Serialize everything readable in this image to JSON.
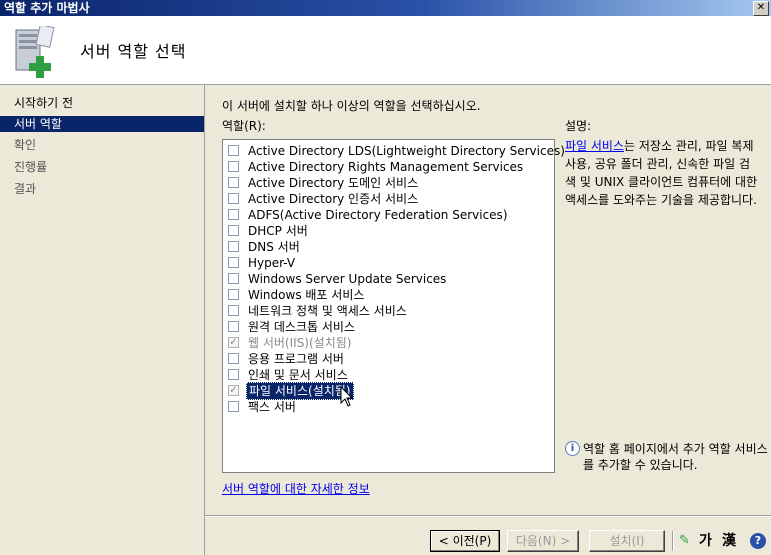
{
  "window": {
    "title": "역할 추가 마법사",
    "close_glyph": "✕"
  },
  "header": {
    "heading": "서버 역할 선택",
    "icon": "server-add-icon"
  },
  "nav": {
    "items": [
      {
        "label": "시작하기 전",
        "state": "normal"
      },
      {
        "label": "서버 역할",
        "state": "active"
      },
      {
        "label": "확인",
        "state": "muted"
      },
      {
        "label": "진행률",
        "state": "muted"
      },
      {
        "label": "결과",
        "state": "muted"
      }
    ]
  },
  "main": {
    "instruction": "이 서버에 설치할 하나 이상의 역할을 선택하십시오.",
    "roles_label": "역할(R):",
    "roles": [
      {
        "label": "Active Directory LDS(Lightweight Directory Services)",
        "checked": false,
        "installed": false
      },
      {
        "label": "Active Directory Rights Management Services",
        "checked": false,
        "installed": false
      },
      {
        "label": "Active Directory 도메인 서비스",
        "checked": false,
        "installed": false
      },
      {
        "label": "Active Directory 인증서 서비스",
        "checked": false,
        "installed": false
      },
      {
        "label": "ADFS(Active Directory Federation Services)",
        "checked": false,
        "installed": false
      },
      {
        "label": "DHCP 서버",
        "checked": false,
        "installed": false
      },
      {
        "label": "DNS 서버",
        "checked": false,
        "installed": false
      },
      {
        "label": "Hyper-V",
        "checked": false,
        "installed": false
      },
      {
        "label": "Windows Server Update Services",
        "checked": false,
        "installed": false
      },
      {
        "label": "Windows 배포 서비스",
        "checked": false,
        "installed": false
      },
      {
        "label": "네트워크 정책 및 액세스 서비스",
        "checked": false,
        "installed": false
      },
      {
        "label": "원격 데스크톱 서비스",
        "checked": false,
        "installed": false
      },
      {
        "label": "웹 서버(IIS)(설치됨)",
        "checked": true,
        "installed": true
      },
      {
        "label": "응용 프로그램 서버",
        "checked": false,
        "installed": false
      },
      {
        "label": "인쇄 및 문서 서비스",
        "checked": false,
        "installed": false
      },
      {
        "label": "파일 서비스(설치됨)",
        "checked": true,
        "installed": true,
        "selected": true
      },
      {
        "label": "팩스 서버",
        "checked": false,
        "installed": false
      }
    ],
    "description_label": "설명:",
    "description_link": "파일 서비스",
    "description_text": "는 저장소 관리, 파일 복제 사용, 공유 폴더 관리, 신속한 파일 검색 및 UNIX 클라이언트 컴퓨터에 대한 액세스를 도와주는 기술을 제공합니다.",
    "note": "역할 홈 페이지에서 추가 역할 서비스를 추가할 수 있습니다.",
    "more_info_link": "서버 역할에 대한 자세한 정보"
  },
  "footer": {
    "back": "< 이전(P)",
    "next": "다음(N) >",
    "install": "설치(I)",
    "ime_hangul": "가",
    "ime_hanja": "漢",
    "help_glyph": "?"
  },
  "colors": {
    "selection": "#0a246a",
    "link": "#0000ee",
    "face": "#ece9d8"
  }
}
